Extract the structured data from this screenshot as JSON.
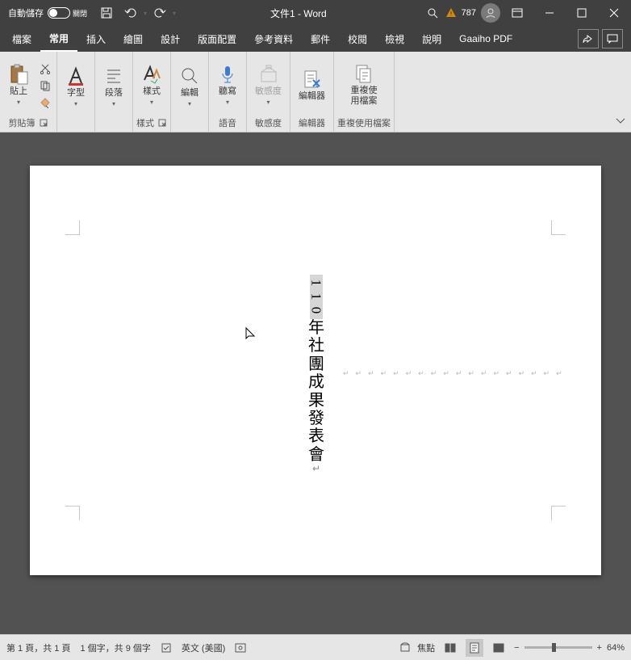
{
  "titlebar": {
    "autosave_label": "自動儲存",
    "toggle_state": "關閉",
    "doc_title": "文件1 - Word",
    "notif_count": "787"
  },
  "tabs": {
    "file": "檔案",
    "home": "常用",
    "insert": "插入",
    "draw": "繪圖",
    "design": "設計",
    "layout": "版面配置",
    "references": "參考資料",
    "mailings": "郵件",
    "review": "校閱",
    "view": "檢視",
    "help": "說明",
    "gaaiho": "Gaaiho PDF"
  },
  "ribbon": {
    "clipboard": {
      "paste": "貼上",
      "group_label": "剪貼簿"
    },
    "font": {
      "btn": "字型",
      "group_label": ""
    },
    "paragraph": {
      "btn": "段落",
      "group_label": ""
    },
    "styles": {
      "btn": "樣式",
      "group_label": "樣式"
    },
    "editing": {
      "btn": "編輯",
      "group_label": ""
    },
    "dictate": {
      "btn": "聽寫",
      "group_label": "語音"
    },
    "sensitivity": {
      "btn": "敏感度",
      "group_label": "敏感度"
    },
    "editor": {
      "btn": "編輯器",
      "group_label": "編輯器"
    },
    "reuse": {
      "btn": "重複使用檔案",
      "group_label": "重複使用檔案"
    }
  },
  "doc": {
    "num": "110",
    "text": "年社團成果發表會",
    "para_mark": "↵"
  },
  "statusbar": {
    "page": "第 1 頁，共 1 頁",
    "words": "1 個字，共 9 個字",
    "language": "英文 (美國)",
    "focus": "焦點",
    "zoom": "64%"
  }
}
